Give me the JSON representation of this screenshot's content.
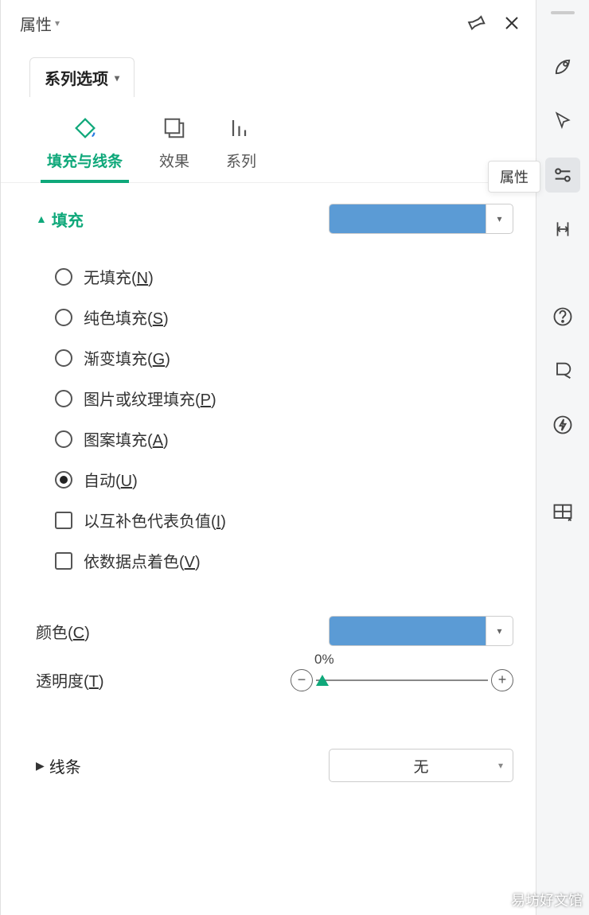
{
  "header": {
    "title": "属性"
  },
  "seriesDropdown": "系列选项",
  "tabs": [
    {
      "label": "填充与线条"
    },
    {
      "label": "效果"
    },
    {
      "label": "系列"
    }
  ],
  "fill": {
    "title": "填充",
    "color": "#5b9bd5",
    "options": {
      "none": "无填充(",
      "none_k": "N",
      "solid": "纯色填充(",
      "solid_k": "S",
      "gradient": "渐变填充(",
      "gradient_k": "G",
      "picture": "图片或纹理填充(",
      "picture_k": "P",
      "pattern": "图案填充(",
      "pattern_k": "A",
      "auto": "自动(",
      "auto_k": "U"
    },
    "checks": {
      "invert": "以互补色代表负值(",
      "invert_k": "I",
      "vary": "依数据点着色(",
      "vary_k": "V"
    },
    "closeParen": ")",
    "colorLabel": "颜色(",
    "colorLabel_k": "C",
    "transparencyLabel": "透明度(",
    "transparencyLabel_k": "T",
    "transparencyValue": "0%"
  },
  "line": {
    "title": "线条",
    "value": "无"
  },
  "tooltip": "属性",
  "watermark": "易坊好文馆"
}
